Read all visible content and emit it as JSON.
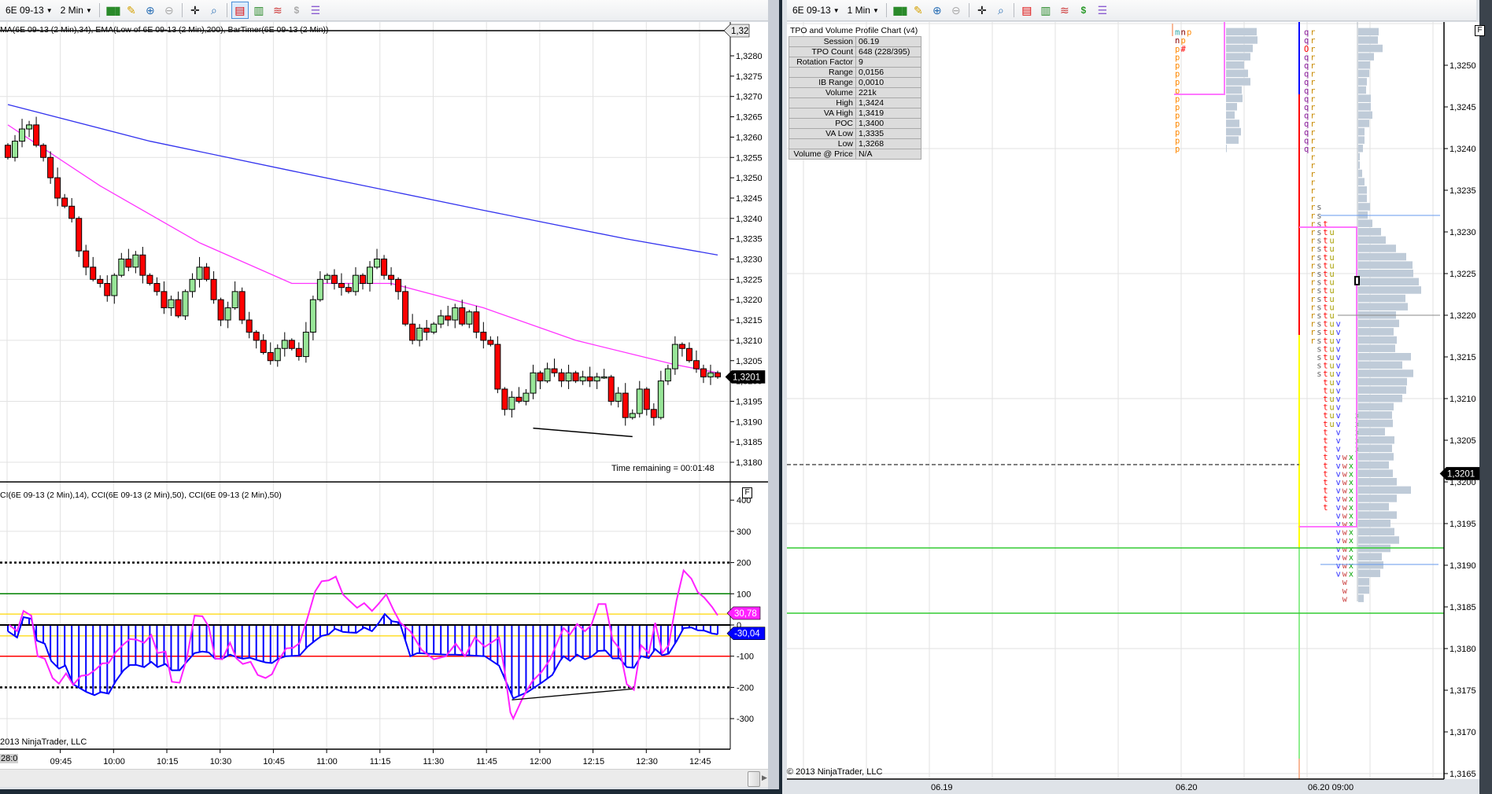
{
  "left_window": {
    "toolbar": {
      "instrument": "6E 09-13",
      "interval": "2 Min"
    },
    "price_panel": {
      "indicator_label": "MA(6E 09-13 (2 Min),34), EMA(Low of 6E 09-13 (2 Min),200), BarTimer(6E 09-13 (2 Min))",
      "time_remaining": "Time remaining = 00:01:48",
      "top_tag": "1,32",
      "last_price_tag": "1,3201",
      "price_axis": [
        "1,3280",
        "1,3275",
        "1,3270",
        "1,3265",
        "1,3260",
        "1,3255",
        "1,3250",
        "1,3245",
        "1,3240",
        "1,3235",
        "1,3230",
        "1,3225",
        "1,3220",
        "1,3215",
        "1,3210",
        "1,3205",
        "1,3200",
        "1,3195",
        "1,3190",
        "1,3185",
        "1,3180"
      ]
    },
    "cci_panel": {
      "label": "CI(6E 09-13 (2 Min),14), CCI(6E 09-13 (2 Min),50), CCI(6E 09-13 (2 Min),50)",
      "axis": [
        "400",
        "300",
        "200",
        "100",
        "0",
        "-100",
        "-200",
        "-300"
      ],
      "cci14_tag": "30,78",
      "cci50_tag": "-30,04",
      "f_button": "F"
    },
    "time_axis": {
      "first": "28:0",
      "labels": [
        "09:45",
        "10:00",
        "10:15",
        "10:30",
        "10:45",
        "11:00",
        "11:15",
        "11:30",
        "11:45",
        "12:00",
        "12:15",
        "12:30",
        "12:45"
      ]
    },
    "copyright": "2013 NinjaTrader, LLC"
  },
  "right_window": {
    "toolbar": {
      "instrument": "6E 09-13",
      "interval": "1 Min"
    },
    "price_axis": [
      "1,3250",
      "1,3245",
      "1,3240",
      "1,3235",
      "1,3230",
      "1,3225",
      "1,3220",
      "1,3215",
      "1,3210",
      "1,3205",
      "1,3200",
      "1,3195",
      "1,3190",
      "1,3185",
      "1,3180",
      "1,3175",
      "1,3170",
      "1,3165"
    ],
    "last_price_tag": "1,3201",
    "f_button": "F",
    "date_labels": [
      "06.19",
      "06.20",
      "06.20 09:00"
    ],
    "copyright": "© 2013 NinjaTrader, LLC",
    "tpo_table": {
      "title": "TPO and Volume Profile Chart (v4)",
      "rows": [
        {
          "k": "Session",
          "v": "06.19"
        },
        {
          "k": "TPO Count",
          "v": "648 (228/395)"
        },
        {
          "k": "Rotation Factor",
          "v": "9"
        },
        {
          "k": "Range",
          "v": "0,0156"
        },
        {
          "k": "IB Range",
          "v": "0,0010"
        },
        {
          "k": "Volume",
          "v": "221k"
        },
        {
          "k": "High",
          "v": "1,3424"
        },
        {
          "k": "VA High",
          "v": "1,3419"
        },
        {
          "k": "POC",
          "v": "1,3400"
        },
        {
          "k": "VA Low",
          "v": "1,3335"
        },
        {
          "k": "Low",
          "v": "1,3268"
        },
        {
          "k": "Volume @ Price",
          "v": "N/A"
        }
      ]
    },
    "tpo_session1": {
      "top_price": 1.3254,
      "rows": [
        "mnp",
        "np",
        "p#",
        "p",
        "p",
        "p",
        "p",
        "p",
        "p",
        "p",
        "p",
        "p",
        "p",
        "p",
        "p"
      ],
      "volume": [
        39,
        40,
        34,
        31,
        23,
        28,
        31,
        20,
        21,
        14,
        11,
        17,
        19,
        16,
        1
      ]
    },
    "tpo_session2": {
      "top_price": 1.3254,
      "columns": "qrstuvwx",
      "rows": [
        "qr",
        "qr",
        "Or",
        "qr",
        "qr",
        "qr",
        "qr",
        "qr",
        "qr",
        "qr",
        "qr",
        "qr",
        "qr",
        "qr",
        "qr",
        " r",
        " r",
        " r",
        " r",
        " r",
        " r",
        " rs",
        " rs",
        " rst",
        " rstu",
        " rstu",
        " rstu",
        " rstu",
        " rstu",
        " rstu",
        " rstu",
        " rstu",
        " rstu",
        " rstu",
        " rstu",
        " rstuv",
        " rstuv",
        " rstuv",
        "  stuv",
        "  stuv",
        "  stuv",
        "  stuv",
        "   tuv",
        "   tuv",
        "   tuv",
        "   tuv",
        "   tuv  x",
        "   tuv  x",
        "   t v  x",
        "   t v  x",
        "   t v  x",
        "   t vwx",
        "   t vwx",
        "   t vwx",
        "   t vwx",
        "   t vwx",
        "   t vwx",
        "   t vwx",
        "     vwx",
        "     vwx",
        "     vwx",
        "     vwx",
        "     vwx",
        "     vwx",
        "     vwx",
        "     vwx",
        "      w",
        "      w",
        "      w"
      ],
      "volume": [
        26,
        25,
        31,
        20,
        15,
        14,
        11,
        10,
        16,
        16,
        18,
        14,
        8,
        8,
        6,
        2,
        2,
        5,
        8,
        11,
        11,
        15,
        12,
        18,
        29,
        35,
        48,
        61,
        69,
        70,
        77,
        80,
        60,
        63,
        48,
        52,
        45,
        49,
        47,
        67,
        56,
        70,
        62,
        61,
        56,
        45,
        43,
        44,
        34,
        46,
        43,
        45,
        39,
        44,
        49,
        67,
        49,
        39,
        49,
        41,
        46,
        52,
        41,
        30,
        32,
        28,
        14,
        14,
        7
      ]
    }
  },
  "colors": {
    "up_candle": "#98e698",
    "down_candle": "#ff0000",
    "ema34": "#ff33ff",
    "ema200": "#3333ee",
    "cci14": "#ff22ff",
    "cci50": "#0000ff",
    "cci_plus100": "#008000",
    "cci_minus100": "#ff0000",
    "cci_band": "#ffd700",
    "va_line": "#ff77ff",
    "volume_bar": "#bfcbd8",
    "letters": {
      "m": "#33aaaa",
      "n": "#880000",
      "p": "#ff8800",
      "O": "#ff0000",
      "#": "#ff0000",
      "q": "#8a1a9a",
      "r": "#c88a00",
      "s": "#666666",
      "t": "#ff0000",
      "u": "#a8a000",
      "v": "#3333ff",
      "w": "#cc4444",
      "x": "#11aa11"
    }
  },
  "price_series": {
    "closes": [
      1.3255,
      1.3259,
      1.3262,
      1.3263,
      1.3258,
      1.3255,
      1.325,
      1.3245,
      1.3243,
      1.324,
      1.3232,
      1.3228,
      1.3225,
      1.3224,
      1.3221,
      1.3226,
      1.323,
      1.3228,
      1.3231,
      1.3226,
      1.3224,
      1.3222,
      1.3218,
      1.322,
      1.3216,
      1.3222,
      1.3225,
      1.3228,
      1.3225,
      1.322,
      1.3215,
      1.3218,
      1.3222,
      1.3215,
      1.3212,
      1.321,
      1.3207,
      1.3205,
      1.3208,
      1.321,
      1.3208,
      1.3206,
      1.3212,
      1.322,
      1.3225,
      1.3226,
      1.3224,
      1.3223,
      1.3222,
      1.3226,
      1.3224,
      1.3228,
      1.323,
      1.3226,
      1.3225,
      1.3222,
      1.3214,
      1.321,
      1.3213,
      1.3212,
      1.3214,
      1.3216,
      1.3215,
      1.3218,
      1.3214,
      1.3217,
      1.3212,
      1.321,
      1.3209,
      1.3198,
      1.3193,
      1.3196,
      1.3195,
      1.3197,
      1.3202,
      1.32,
      1.3203,
      1.3202,
      1.32,
      1.3202,
      1.32,
      1.3201,
      1.32,
      1.3201,
      1.3201,
      1.3195,
      1.3197,
      1.3191,
      1.3192,
      1.3198,
      1.3193,
      1.3191,
      1.32,
      1.3203,
      1.3209,
      1.3208,
      1.3205,
      1.3203,
      1.3201,
      1.3202,
      1.3201
    ],
    "ema34": [
      [
        0,
        1.3263
      ],
      [
        13,
        1.3248
      ],
      [
        27,
        1.3234
      ],
      [
        40,
        1.3224
      ],
      [
        54,
        1.3224
      ],
      [
        67,
        1.3218
      ],
      [
        80,
        1.321
      ],
      [
        94,
        1.3204
      ],
      [
        100,
        1.3202
      ]
    ],
    "ema200": [
      [
        0,
        1.3268
      ],
      [
        20,
        1.3259
      ],
      [
        40,
        1.32517
      ],
      [
        67,
        1.3242
      ],
      [
        87,
        1.3235
      ],
      [
        100,
        1.3231
      ]
    ],
    "trendline": [
      [
        74,
        1.31884
      ],
      [
        88,
        1.31863
      ]
    ]
  },
  "cci_series": {
    "cci50": [
      [
        0,
        -20
      ],
      [
        1.3,
        -40
      ],
      [
        2.2,
        25
      ],
      [
        3.3,
        20
      ],
      [
        4.1,
        -50
      ],
      [
        5.2,
        -60
      ],
      [
        6.1,
        -115
      ],
      [
        7.2,
        -140
      ],
      [
        8.1,
        -130
      ],
      [
        9.2,
        -190
      ],
      [
        11.1,
        -215
      ],
      [
        12.2,
        -225
      ],
      [
        13.1,
        -215
      ],
      [
        14.2,
        -220
      ],
      [
        15.2,
        -180
      ],
      [
        16.3,
        -145
      ],
      [
        17.2,
        -128
      ],
      [
        18.1,
        -128
      ],
      [
        19.2,
        -135
      ],
      [
        20.2,
        -118
      ],
      [
        21.1,
        -135
      ],
      [
        22.2,
        -125
      ],
      [
        23.1,
        -145
      ],
      [
        24.2,
        -145
      ],
      [
        25.2,
        -118
      ],
      [
        26.3,
        -90
      ],
      [
        27.4,
        -85
      ],
      [
        28.3,
        -88
      ],
      [
        29.2,
        -108
      ],
      [
        30.2,
        -108
      ],
      [
        31.3,
        -95
      ],
      [
        32.2,
        -103
      ],
      [
        33.1,
        -108
      ],
      [
        34.1,
        -105
      ],
      [
        35.2,
        -113
      ],
      [
        36.3,
        -120
      ],
      [
        37.2,
        -122
      ],
      [
        38.1,
        -108
      ],
      [
        39.2,
        -100
      ],
      [
        41.1,
        -98
      ],
      [
        42.2,
        -70
      ],
      [
        43.3,
        -50
      ],
      [
        44.2,
        -35
      ],
      [
        45.2,
        -30
      ],
      [
        46.1,
        -12
      ],
      [
        47.2,
        -22
      ],
      [
        48.1,
        -24
      ],
      [
        49.1,
        -25
      ],
      [
        50.2,
        -8
      ],
      [
        51.3,
        -20
      ],
      [
        52.2,
        5
      ],
      [
        53.1,
        35
      ],
      [
        54.1,
        12
      ],
      [
        55.2,
        8
      ],
      [
        56.7,
        -100
      ],
      [
        57.7,
        -90
      ],
      [
        61.7,
        -95
      ],
      [
        63.1,
        -95
      ],
      [
        67.2,
        -100
      ],
      [
        69.2,
        -130
      ],
      [
        71.2,
        -235
      ],
      [
        73.2,
        -215
      ],
      [
        75.2,
        -185
      ],
      [
        76.7,
        -160
      ],
      [
        77.8,
        -115
      ],
      [
        78.3,
        -100
      ],
      [
        79.2,
        -115
      ],
      [
        80.2,
        -95
      ],
      [
        81.3,
        -110
      ],
      [
        82.2,
        -102
      ],
      [
        83.2,
        -83
      ],
      [
        84.2,
        -82
      ],
      [
        85.2,
        -107
      ],
      [
        86.2,
        -107
      ],
      [
        87.2,
        -135
      ],
      [
        88.2,
        -137
      ],
      [
        89.2,
        -100
      ],
      [
        90.3,
        -106
      ],
      [
        91.2,
        -77
      ],
      [
        92.2,
        -97
      ],
      [
        93.1,
        -92
      ],
      [
        94.2,
        -52
      ],
      [
        95.2,
        -10
      ],
      [
        96.3,
        -8
      ],
      [
        97.2,
        -17
      ],
      [
        98.1,
        -18
      ],
      [
        99.2,
        -27
      ],
      [
        100,
        -30
      ]
    ],
    "cci14": [
      [
        0.2,
        0
      ],
      [
        1.3,
        -20
      ],
      [
        2.2,
        45
      ],
      [
        3.3,
        30
      ],
      [
        4.2,
        -100
      ],
      [
        5.2,
        -108
      ],
      [
        6.3,
        -170
      ],
      [
        7.2,
        -188
      ],
      [
        8.2,
        -155
      ],
      [
        9.2,
        -192
      ],
      [
        10.3,
        -163
      ],
      [
        11.3,
        -160
      ],
      [
        12.4,
        -142
      ],
      [
        13.3,
        -123
      ],
      [
        14.2,
        -122
      ],
      [
        15.2,
        -87
      ],
      [
        16.3,
        -62
      ],
      [
        17.2,
        -45
      ],
      [
        18.1,
        -47
      ],
      [
        19.2,
        -57
      ],
      [
        20.2,
        -32
      ],
      [
        21.1,
        -90
      ],
      [
        22.2,
        -85
      ],
      [
        23.1,
        -182
      ],
      [
        24.2,
        -185
      ],
      [
        25.2,
        -108
      ],
      [
        26.3,
        30
      ],
      [
        27.4,
        28
      ],
      [
        28.3,
        -5
      ],
      [
        29.2,
        -107
      ],
      [
        30.2,
        -110
      ],
      [
        31.3,
        -57
      ],
      [
        32.2,
        -107
      ],
      [
        33.1,
        -125
      ],
      [
        34.2,
        -118
      ],
      [
        35.2,
        -160
      ],
      [
        36.3,
        -170
      ],
      [
        37.2,
        -158
      ],
      [
        38.1,
        -115
      ],
      [
        39.2,
        -75
      ],
      [
        40.2,
        -73
      ],
      [
        41.1,
        -58
      ],
      [
        42.2,
        22
      ],
      [
        43.3,
        108
      ],
      [
        44.2,
        140
      ],
      [
        45.2,
        143
      ],
      [
        46.2,
        155
      ],
      [
        47.2,
        98
      ],
      [
        48.1,
        78
      ],
      [
        49.2,
        55
      ],
      [
        50.2,
        70
      ],
      [
        51.3,
        45
      ],
      [
        52.2,
        67
      ],
      [
        53.3,
        98
      ],
      [
        54.4,
        45
      ],
      [
        55.3,
        7
      ],
      [
        56.7,
        -20
      ],
      [
        58.3,
        -80
      ],
      [
        60,
        -110
      ],
      [
        61.7,
        -100
      ],
      [
        63.1,
        -60
      ],
      [
        64.4,
        -100
      ],
      [
        65.8,
        -40
      ],
      [
        67.2,
        -70
      ],
      [
        69.2,
        -40
      ],
      [
        70,
        -150
      ],
      [
        70.8,
        -280
      ],
      [
        71.2,
        -300
      ],
      [
        72.6,
        -230
      ],
      [
        73.9,
        -180
      ],
      [
        75.2,
        -150
      ],
      [
        76.4,
        -110
      ],
      [
        77.8,
        -35
      ],
      [
        78.3,
        -10
      ],
      [
        79.2,
        -30
      ],
      [
        80.2,
        3
      ],
      [
        81.3,
        -20
      ],
      [
        82.2,
        0
      ],
      [
        83.2,
        67
      ],
      [
        84.2,
        67
      ],
      [
        85.2,
        -48
      ],
      [
        86.2,
        -77
      ],
      [
        87.2,
        -190
      ],
      [
        88.2,
        -208
      ],
      [
        89.2,
        -65
      ],
      [
        90.3,
        -90
      ],
      [
        91.2,
        7
      ],
      [
        92.2,
        -90
      ],
      [
        93.1,
        -65
      ],
      [
        94.2,
        78
      ],
      [
        95.2,
        175
      ],
      [
        96.3,
        148
      ],
      [
        97.2,
        105
      ],
      [
        98.1,
        88
      ],
      [
        99.2,
        58
      ],
      [
        100,
        31
      ]
    ],
    "trendline": [
      [
        71,
        -240
      ],
      [
        88,
        -205
      ]
    ],
    "levels": {
      "overbought": 200,
      "oversold": -200,
      "plus100": 100,
      "minus100": -100,
      "band": 35
    }
  }
}
